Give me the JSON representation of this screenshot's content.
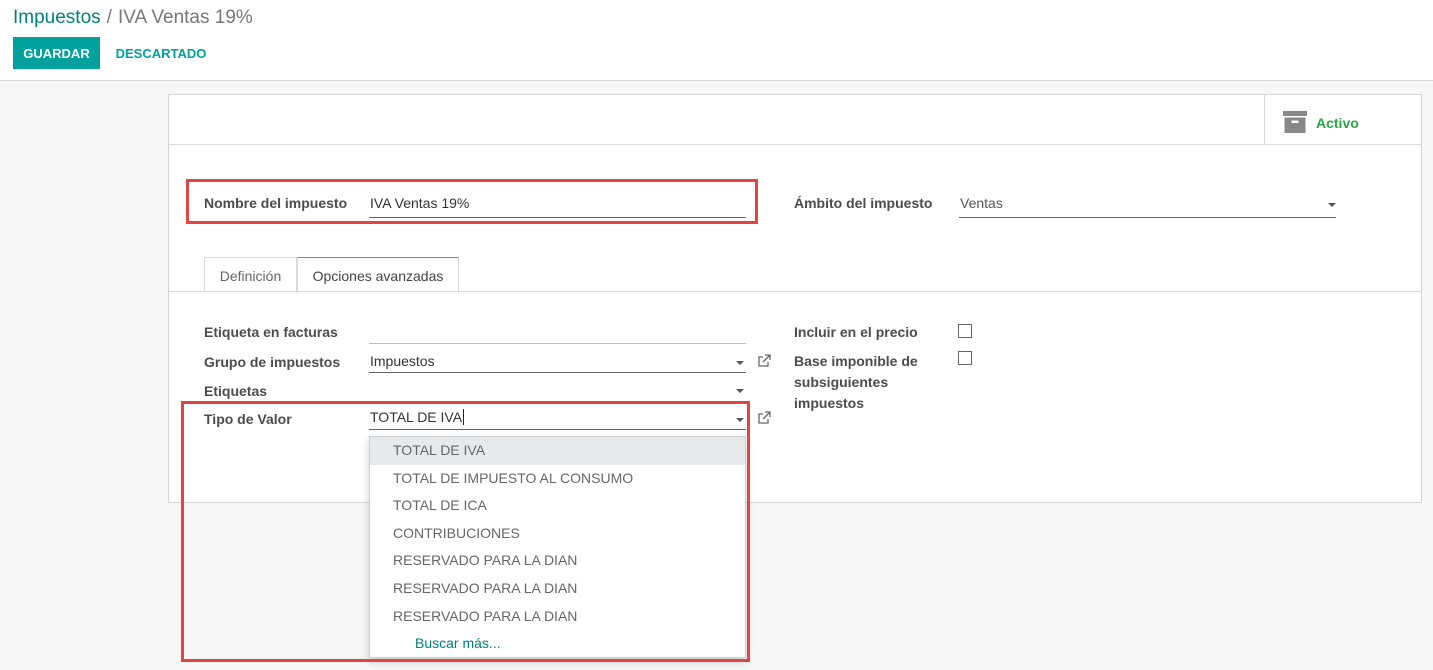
{
  "breadcrumb": {
    "parent": "Impuestos",
    "separator": "/",
    "current": "IVA Ventas 19%"
  },
  "buttons": {
    "save": "GUARDAR",
    "discard": "DESCARTADO"
  },
  "smart_button": {
    "label": "Activo",
    "icon": "archive-icon"
  },
  "fields": {
    "tax_name": {
      "label": "Nombre del impuesto",
      "value": "IVA Ventas 19%"
    },
    "tax_scope": {
      "label": "Ámbito del impuesto",
      "value": "Ventas"
    }
  },
  "tabs": [
    {
      "label": "Definición"
    },
    {
      "label": "Opciones avanzadas"
    }
  ],
  "advanced": {
    "invoice_label": {
      "label": "Etiqueta en facturas",
      "value": ""
    },
    "tax_group": {
      "label": "Grupo de impuestos",
      "value": "Impuestos"
    },
    "tags": {
      "label": "Etiquetas",
      "value": ""
    },
    "value_type": {
      "label": "Tipo de Valor",
      "value": "TOTAL DE IVA"
    },
    "include_price": {
      "label": "Incluir en el precio",
      "checked": false
    },
    "base_affected": {
      "label_lines": [
        "Base imponible de",
        "subsiguientes",
        "impuestos"
      ],
      "checked": false
    }
  },
  "dropdown": {
    "items": [
      "TOTAL DE IVA",
      "TOTAL DE IMPUESTO AL CONSUMO",
      "TOTAL DE ICA",
      "CONTRIBUCIONES",
      "RESERVADO PARA LA DIAN",
      "RESERVADO PARA LA DIAN",
      "RESERVADO PARA LA DIAN"
    ],
    "more": "Buscar más..."
  },
  "colors": {
    "primary": "#00a09d",
    "link": "#00827c",
    "active": "#28a745",
    "highlight_box": "#e04444"
  }
}
